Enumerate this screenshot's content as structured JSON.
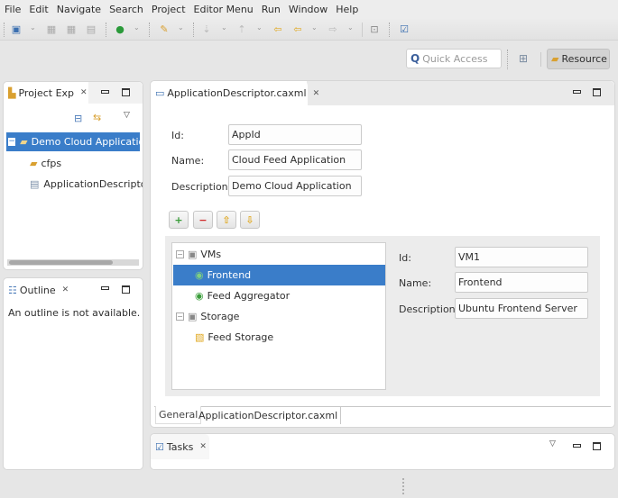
{
  "menu": [
    "File",
    "Edit",
    "Navigate",
    "Search",
    "Project",
    "Editor Menu",
    "Run",
    "Window",
    "Help"
  ],
  "toolbar": {
    "icons": [
      "new-icon",
      "save-icon",
      "save-all-icon",
      "print-icon",
      "run-icon",
      "pencil-icon",
      "next-annotation-icon",
      "prev-annotation-icon",
      "back-icon",
      "forward-icon",
      "open-perspective-icon",
      "tasks-icon"
    ]
  },
  "quick_access": {
    "placeholder": "Quick Access"
  },
  "perspective": {
    "label": "Resource"
  },
  "project_explorer": {
    "tab_label": "Project Exp",
    "tree": [
      {
        "label": "Demo Cloud Application",
        "selected": true,
        "expanded": true
      },
      {
        "label": "cfps"
      },
      {
        "label": "ApplicationDescriptor"
      }
    ]
  },
  "outline": {
    "tab_label": "Outline",
    "message": "An outline is not available."
  },
  "editor": {
    "tab_label": "ApplicationDescriptor.caxml",
    "app_fields": {
      "id_label": "Id:",
      "id_value": "AppId",
      "name_label": "Name:",
      "name_value": "Cloud Feed Application",
      "desc_label": "Description:",
      "desc_value": "Demo Cloud Application"
    },
    "buttons": {
      "add": "+",
      "remove": "−",
      "up": "⇧",
      "down": "⇩"
    },
    "tree": {
      "vms": "VMs",
      "frontend": "Frontend",
      "feed_aggregator": "Feed Aggregator",
      "storage": "Storage",
      "feed_storage": "Feed Storage"
    },
    "detail": {
      "id_label": "Id:",
      "id_value": "VM1",
      "name_label": "Name:",
      "name_value": "Frontend",
      "desc_label": "Description:",
      "desc_value": "Ubuntu Frontend Server"
    },
    "bottom_tabs": [
      "General",
      "ApplicationDescriptor.caxml"
    ]
  },
  "tasks": {
    "tab_label": "Tasks"
  },
  "colors": {
    "selection": "#3a7dc9",
    "accent_green": "#3a9d3a"
  }
}
